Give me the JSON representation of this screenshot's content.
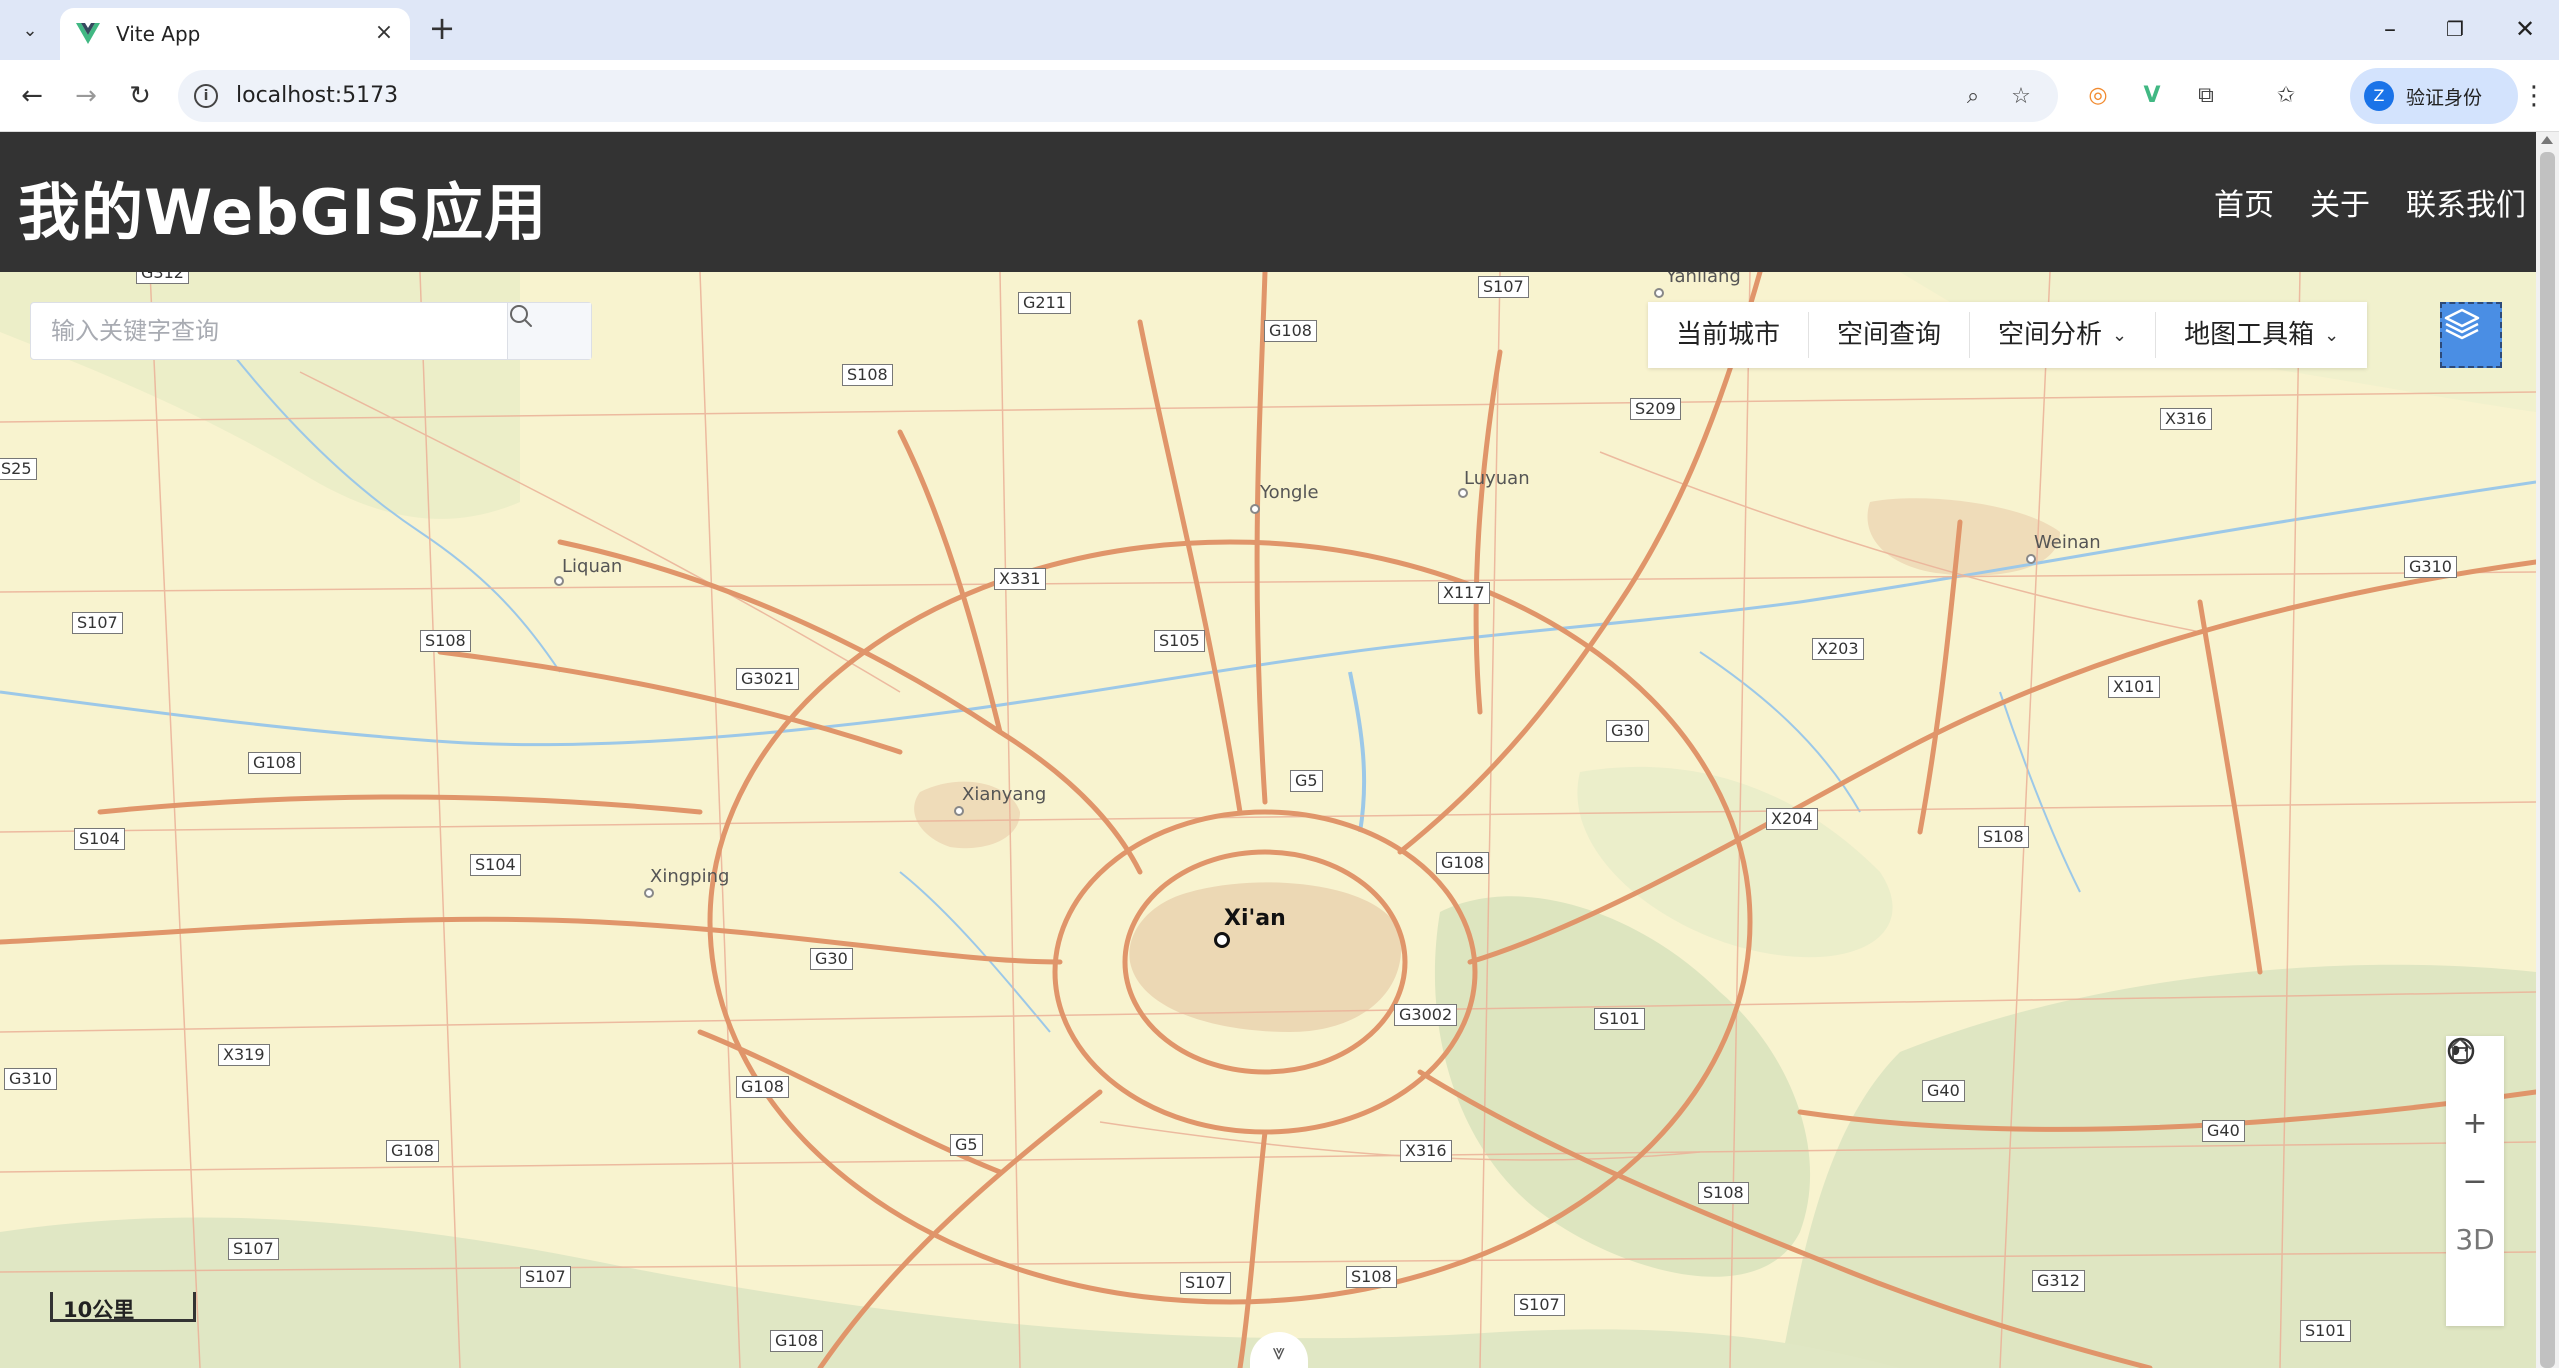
{
  "browser": {
    "tab_title": "Vite App",
    "url": "localhost:5173",
    "profile_button_label": "验证身份",
    "accent_color": "#1a73e8"
  },
  "header": {
    "title": "我的WebGIS应用",
    "nav": [
      "首页",
      "关于",
      "联系我们"
    ],
    "background_color": "#333333"
  },
  "search": {
    "placeholder": "输入关键字查询"
  },
  "map_menu": {
    "items": [
      {
        "label": "当前城市",
        "dropdown": false
      },
      {
        "label": "空间查询",
        "dropdown": false
      },
      {
        "label": "空间分析",
        "dropdown": true
      },
      {
        "label": "地图工具箱",
        "dropdown": true
      }
    ]
  },
  "map_controls": {
    "three_d_label": "3D"
  },
  "scale": {
    "label": "10公里"
  },
  "map": {
    "main_city": "Xi'an",
    "places": [
      "Yanliang",
      "Yongle",
      "Luyuan",
      "Liquan",
      "Weinan",
      "Xianyang",
      "Xingping"
    ],
    "road_shields": [
      "G312",
      "G211",
      "G108",
      "S107",
      "S108",
      "S209",
      "X316",
      "S25",
      "Liquan",
      "X331",
      "X117",
      "S107",
      "S108",
      "G3021",
      "S105",
      "X203",
      "X101",
      "G310",
      "G108",
      "G30",
      "G5",
      "X204",
      "S108",
      "S104",
      "S104",
      "G108",
      "G30",
      "G3002",
      "S101",
      "G310",
      "X319",
      "G108",
      "G40",
      "G40",
      "G5",
      "X316",
      "S108",
      "G108",
      "S107",
      "S107",
      "S108",
      "S107",
      "G312",
      "S107",
      "S101",
      "G108"
    ],
    "background_color": "#f8f3cf",
    "road_color": "#e0956a"
  }
}
